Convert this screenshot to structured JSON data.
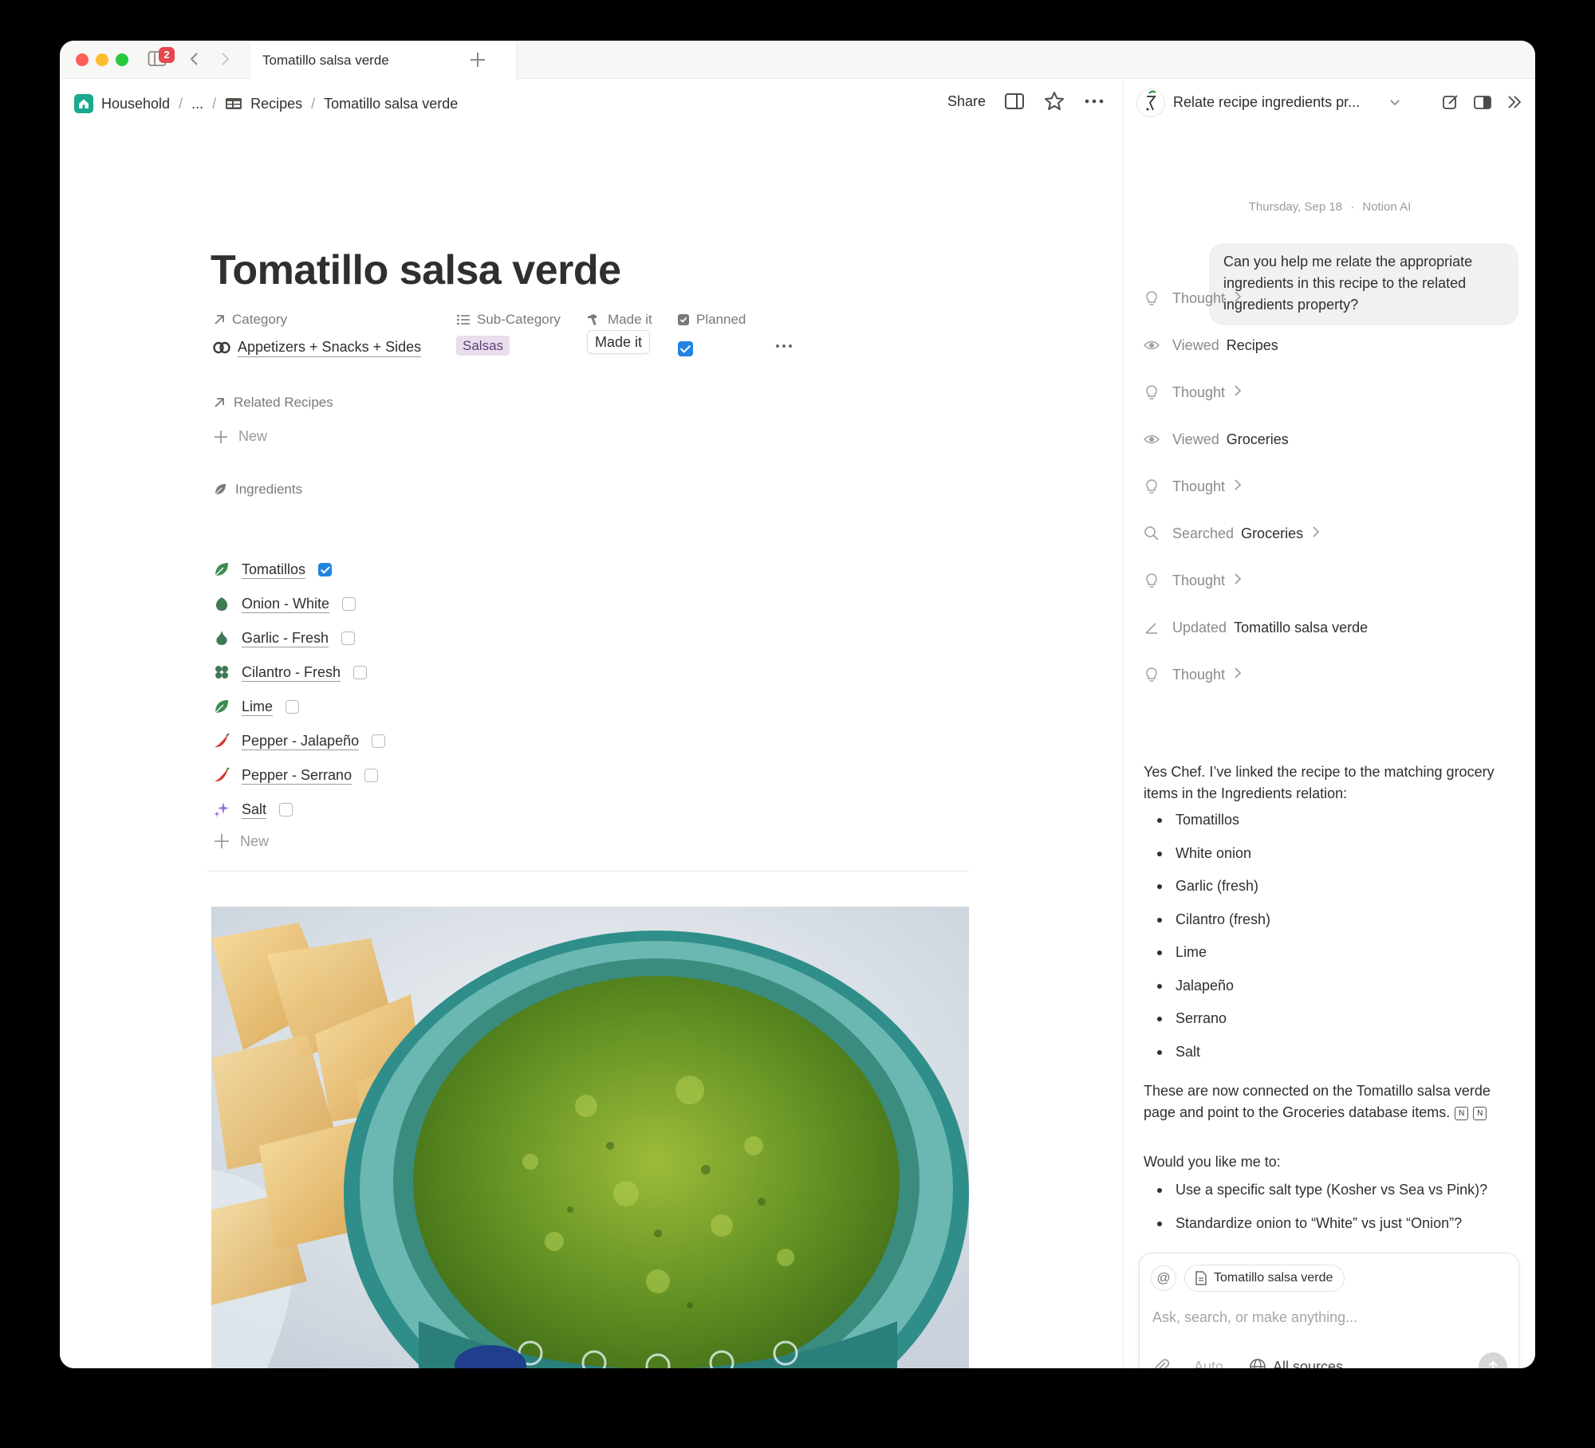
{
  "window": {
    "tab_title": "Tomatillo salsa verde",
    "badge_count": "2"
  },
  "breadcrumb": {
    "workspace": "Household",
    "ellipsis": "...",
    "database": "Recipes",
    "page": "Tomatillo salsa verde"
  },
  "toolbar": {
    "share_label": "Share"
  },
  "page": {
    "title": "Tomatillo salsa verde",
    "properties": {
      "category_label": "Category",
      "category_value": "Appetizers + Snacks + Sides",
      "subcategory_label": "Sub-Category",
      "subcategory_value": "Salsas",
      "made_it_label": "Made it",
      "made_it_value": "Made it",
      "planned_label": "Planned",
      "planned_checked": true
    },
    "related_recipes": {
      "label": "Related Recipes",
      "new_label": "New"
    },
    "ingredients": {
      "label": "Ingredients",
      "new_label": "New",
      "items": [
        {
          "name": "Tomatillos",
          "icon": "leaf-icon",
          "checked": true
        },
        {
          "name": "Onion - White",
          "icon": "onion-icon",
          "checked": false
        },
        {
          "name": "Garlic - Fresh",
          "icon": "garlic-icon",
          "checked": false
        },
        {
          "name": "Cilantro - Fresh",
          "icon": "herb-icon",
          "checked": false
        },
        {
          "name": "Lime",
          "icon": "leaf-icon",
          "checked": false
        },
        {
          "name": "Pepper - Jalapeño",
          "icon": "chili-icon",
          "checked": false
        },
        {
          "name": "Pepper - Serrano",
          "icon": "chili-icon",
          "checked": false
        },
        {
          "name": "Salt",
          "icon": "sparkle-icon",
          "checked": false
        }
      ]
    }
  },
  "ai_panel": {
    "thread_title": "Relate recipe ingredients pr...",
    "date_line": "Thursday, Sep 18",
    "sender": "Notion AI",
    "user_message": "Can you help me relate the appropriate ingredients in this recipe to the related ingredients property?",
    "steps": [
      {
        "verb": "Thought",
        "object": "",
        "icon": "lightbulb-icon",
        "chevron": true
      },
      {
        "verb": "Viewed",
        "object": "Recipes",
        "icon": "eye-icon",
        "chevron": false
      },
      {
        "verb": "Thought",
        "object": "",
        "icon": "lightbulb-icon",
        "chevron": true
      },
      {
        "verb": "Viewed",
        "object": "Groceries",
        "icon": "eye-icon",
        "chevron": false
      },
      {
        "verb": "Thought",
        "object": "",
        "icon": "lightbulb-icon",
        "chevron": true
      },
      {
        "verb": "Searched",
        "object": "Groceries",
        "icon": "search-icon",
        "chevron": true
      },
      {
        "verb": "Thought",
        "object": "",
        "icon": "lightbulb-icon",
        "chevron": true
      },
      {
        "verb": "Updated",
        "object": "Tomatillo salsa verde",
        "icon": "pencil-icon",
        "chevron": false
      },
      {
        "verb": "Thought",
        "object": "",
        "icon": "lightbulb-icon",
        "chevron": true
      }
    ],
    "response_intro": "Yes Chef. I’ve linked the recipe to the matching grocery items in the Ingredients relation:",
    "linked_items": [
      "Tomatillos",
      "White onion",
      "Garlic (fresh)",
      "Cilantro (fresh)",
      "Lime",
      "Jalapeño",
      "Serrano",
      "Salt"
    ],
    "response_outro": "These are now connected on the Tomatillo salsa verde page and point to the Groceries database items.",
    "followup_question": "Would you like me to:",
    "followup_options": [
      "Use a specific salt type (Kosher vs Sea vs Pink)?",
      "Standardize onion to “White” vs just “Onion”?"
    ],
    "composer": {
      "at_symbol": "@",
      "context_page": "Tomatillo salsa verde",
      "placeholder": "Ask, search, or make anything...",
      "mode": "Auto",
      "sources": "All sources"
    }
  }
}
